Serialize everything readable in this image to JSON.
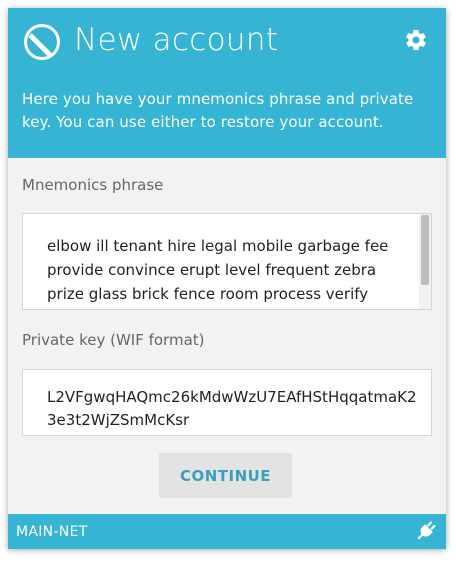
{
  "header": {
    "title": "New account",
    "subtitle": "Here you have your mnemonics phrase and private key. You can use either to restore your account.",
    "logo_icon": "ontology-logo-icon",
    "settings_icon": "gear-icon"
  },
  "mnemonic": {
    "label": "Mnemonics phrase",
    "value": "elbow ill tenant hire legal mobile garbage fee provide convince erupt level frequent zebra prize glass brick fence room process verify"
  },
  "private_key": {
    "label": "Private key (WIF format)",
    "value": "L2VFgwqHAQmc26kMdwWzU7EAfHStHqqatmaK23e3t2WjZSmMcKsr"
  },
  "actions": {
    "continue_label": "CONTINUE"
  },
  "footer": {
    "network": "MAIN-NET",
    "status_icon": "plug-icon"
  },
  "colors": {
    "accent": "#35b4d4",
    "button_text": "#3a9fbf",
    "background": "#f2f2f2"
  }
}
